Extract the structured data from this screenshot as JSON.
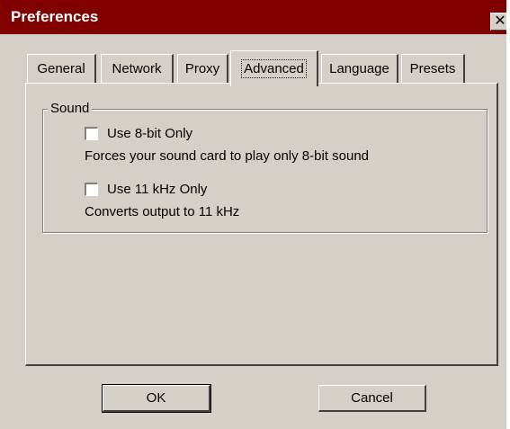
{
  "window": {
    "title": "Preferences",
    "close_glyph": "✕"
  },
  "tabs": [
    {
      "label": "General",
      "active": false
    },
    {
      "label": "Network",
      "active": false
    },
    {
      "label": "Proxy",
      "active": false
    },
    {
      "label": "Advanced",
      "active": true
    },
    {
      "label": "Language",
      "active": false
    },
    {
      "label": "Presets",
      "active": false
    }
  ],
  "sound": {
    "group_label": "Sound",
    "options": [
      {
        "label": "Use 8-bit Only",
        "checked": false,
        "description": "Forces your sound card to play only 8-bit sound"
      },
      {
        "label": "Use 11 kHz Only",
        "checked": false,
        "description": "Converts output to 11 kHz"
      }
    ]
  },
  "buttons": {
    "ok": "OK",
    "cancel": "Cancel"
  },
  "colors": {
    "titlebar": "#800000",
    "face": "#d4d0c8"
  }
}
